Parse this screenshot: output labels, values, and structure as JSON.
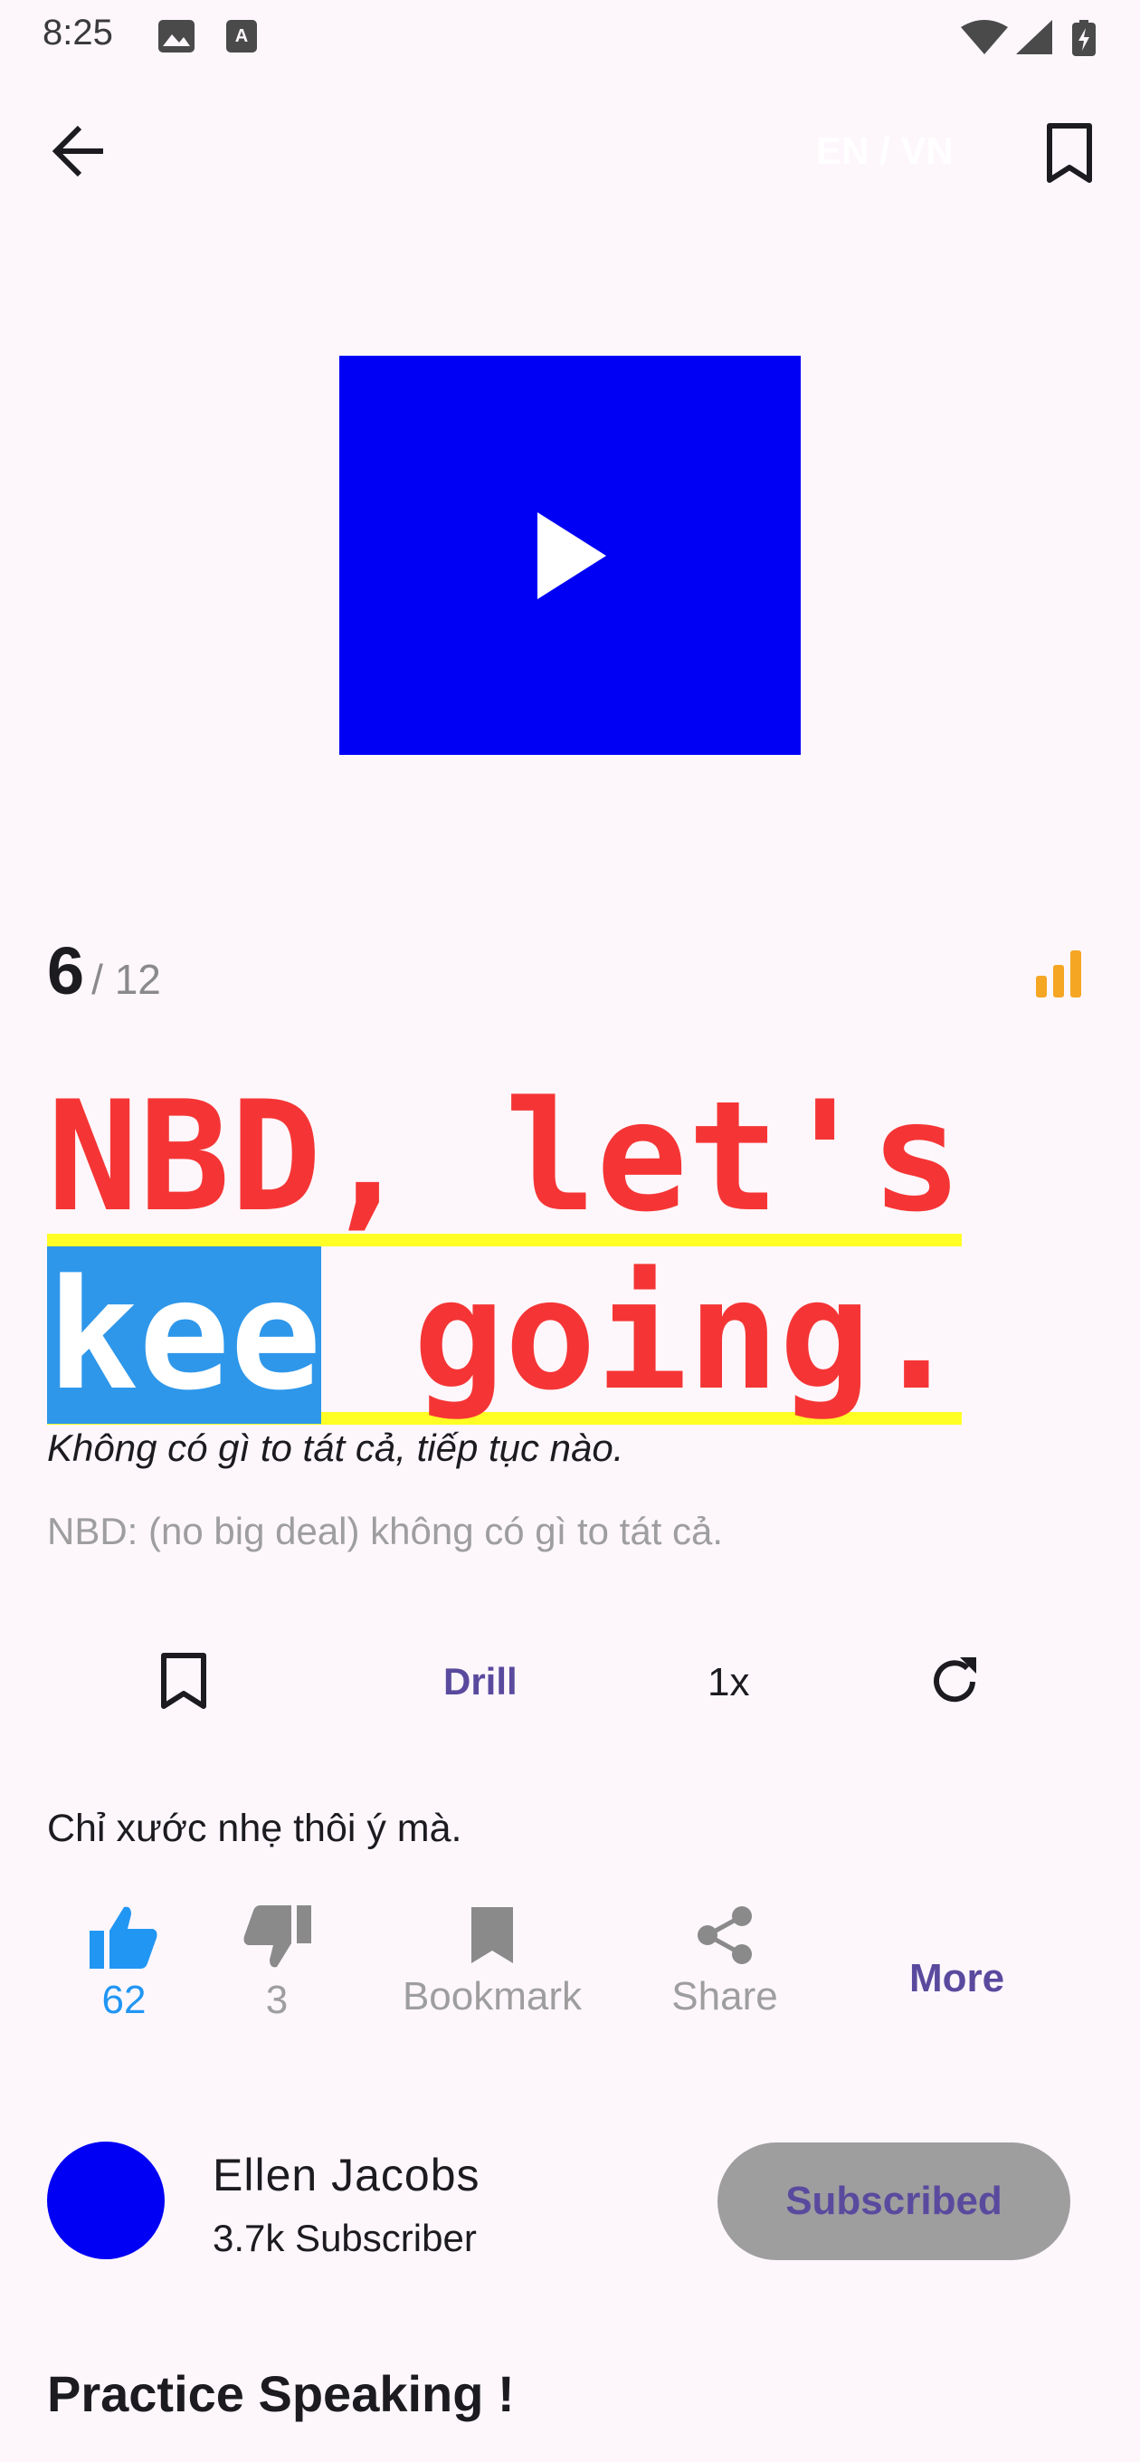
{
  "status_bar": {
    "time": "8:25",
    "icons": [
      "image-icon",
      "font-icon",
      "wifi-icon",
      "signal-icon",
      "battery-charging-icon"
    ]
  },
  "app_bar": {
    "language_toggle": "EN / VN",
    "icons": [
      "back-arrow-icon",
      "bookmark-outline-icon"
    ]
  },
  "video": {
    "icon": "play-icon",
    "color": "#0000f5"
  },
  "progress": {
    "current": "6",
    "total": "/ 12",
    "level_icon": "signal-bars-icon",
    "level_color": "#f5a623"
  },
  "lesson": {
    "sentence_line1": "NBD, let's",
    "sentence_line2_highlight": "kee",
    "sentence_line2_rest": " going.",
    "translation": "Không có gì to tát cả, tiếp tục nào.",
    "note": "NBD: (no big deal) không có gì to tát cả.",
    "sentence_color": "#f53535",
    "highlight_color": "#2e97ea",
    "underline_color": "#ffff26"
  },
  "controls": {
    "drill_label": "Drill",
    "speed_label": "1x",
    "icons": [
      "bookmark-outline-icon",
      "replay-icon"
    ]
  },
  "subtitle_text": "Chỉ xước nhẹ thôi ý mà.",
  "actions": {
    "like_count": "62",
    "dislike_count": "3",
    "bookmark_label": "Bookmark",
    "share_label": "Share",
    "more_label": "More",
    "accent_color": "#2196f3"
  },
  "channel": {
    "name": "Ellen Jacobs",
    "subscribers": "3.7k Subscriber",
    "subscribe_label": "Subscribed"
  },
  "section_title": "Practice Speaking !"
}
